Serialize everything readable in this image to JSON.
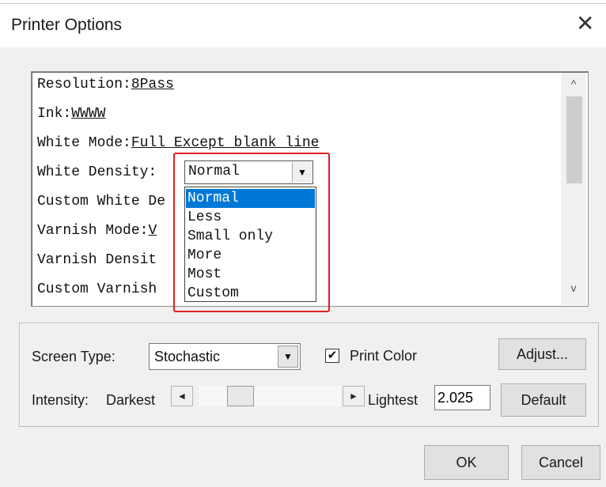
{
  "window": {
    "title": "Printer Options",
    "close_glyph": "✕"
  },
  "properties": {
    "rows": [
      {
        "label": "Resolution:",
        "value": "8Pass"
      },
      {
        "label": "Ink:",
        "value": "WWWW"
      },
      {
        "label": "White Mode:",
        "value": "Full Except blank line"
      },
      {
        "label": "White Density:",
        "value": "Normal"
      },
      {
        "label": "Custom White De",
        "value": ""
      },
      {
        "label": "Varnish Mode:",
        "value": "V"
      },
      {
        "label": "Varnish Densit",
        "value": ""
      },
      {
        "label": "Custom Varnish",
        "value": ""
      }
    ],
    "white_density_select": {
      "selected": "Normal",
      "arrow_glyph": "▼"
    },
    "white_density_options": [
      "Normal",
      "Less",
      "Small only",
      "More",
      "Most",
      "Custom"
    ],
    "highlighted_option": "Normal",
    "scroll_up_glyph": "^",
    "scroll_down_glyph": "v"
  },
  "screen": {
    "screen_type_label": "Screen Type:",
    "screen_type_value": "Stochastic",
    "arrow_glyph": "▼",
    "print_color_label": "Print Color",
    "print_color_checked": true,
    "check_glyph": "✔",
    "adjust_label": "Adjust...",
    "intensity_label": "Intensity:",
    "darkest_label": "Darkest",
    "lightest_label": "Lightest",
    "left_glyph": "◄",
    "right_glyph": "►",
    "intensity_value": "2.025",
    "default_label": "Default"
  },
  "footer": {
    "ok_label": "OK",
    "cancel_label": "Cancel"
  },
  "colors": {
    "highlight_box": "#e02020",
    "selection": "#0078d7",
    "dialog_bg": "#f0f0f0"
  }
}
